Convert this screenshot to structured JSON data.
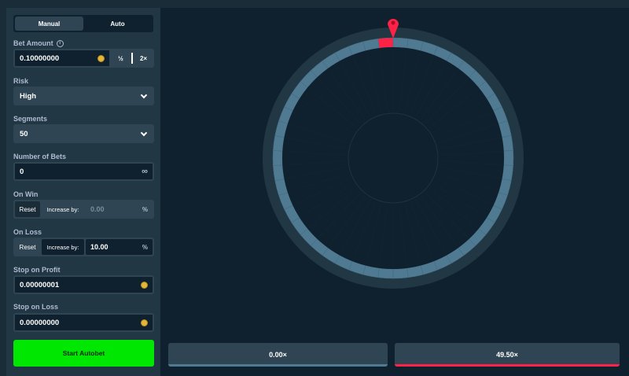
{
  "mode_tabs": {
    "manual": "Manual",
    "auto": "Auto",
    "active": "Auto"
  },
  "bet_amount": {
    "label": "Bet Amount",
    "value": "0.10000000",
    "half_label": "½",
    "double_label": "2×"
  },
  "risk": {
    "label": "Risk",
    "value": "High"
  },
  "segments": {
    "label": "Segments",
    "value": "50"
  },
  "number_of_bets": {
    "label": "Number of Bets",
    "value": "0",
    "infinity_symbol": "∞"
  },
  "on_win": {
    "label": "On Win",
    "reset_label": "Reset",
    "increase_label": "Increase by:",
    "value": "0.00",
    "unit": "%"
  },
  "on_loss": {
    "label": "On Loss",
    "reset_label": "Reset",
    "increase_label": "Increase by:",
    "value": "10.00",
    "unit": "%"
  },
  "stop_on_profit": {
    "label": "Stop on Profit",
    "value": "0.00000001"
  },
  "stop_on_loss": {
    "label": "Stop on Loss",
    "value": "0.00000000"
  },
  "start_button": {
    "label": "Start Autobet"
  },
  "wheel": {
    "segments": 50,
    "base_color": "#4f7a92",
    "win_color": "#fe2247",
    "pointer_color": "#fe2247"
  },
  "multipliers": [
    {
      "label": "0.00×",
      "color": "#4f7a92"
    },
    {
      "label": "49.50×",
      "color": "#fe2247"
    }
  ],
  "colors": {
    "accent_green": "#00e701",
    "panel": "#213743",
    "background": "#0f212e"
  }
}
